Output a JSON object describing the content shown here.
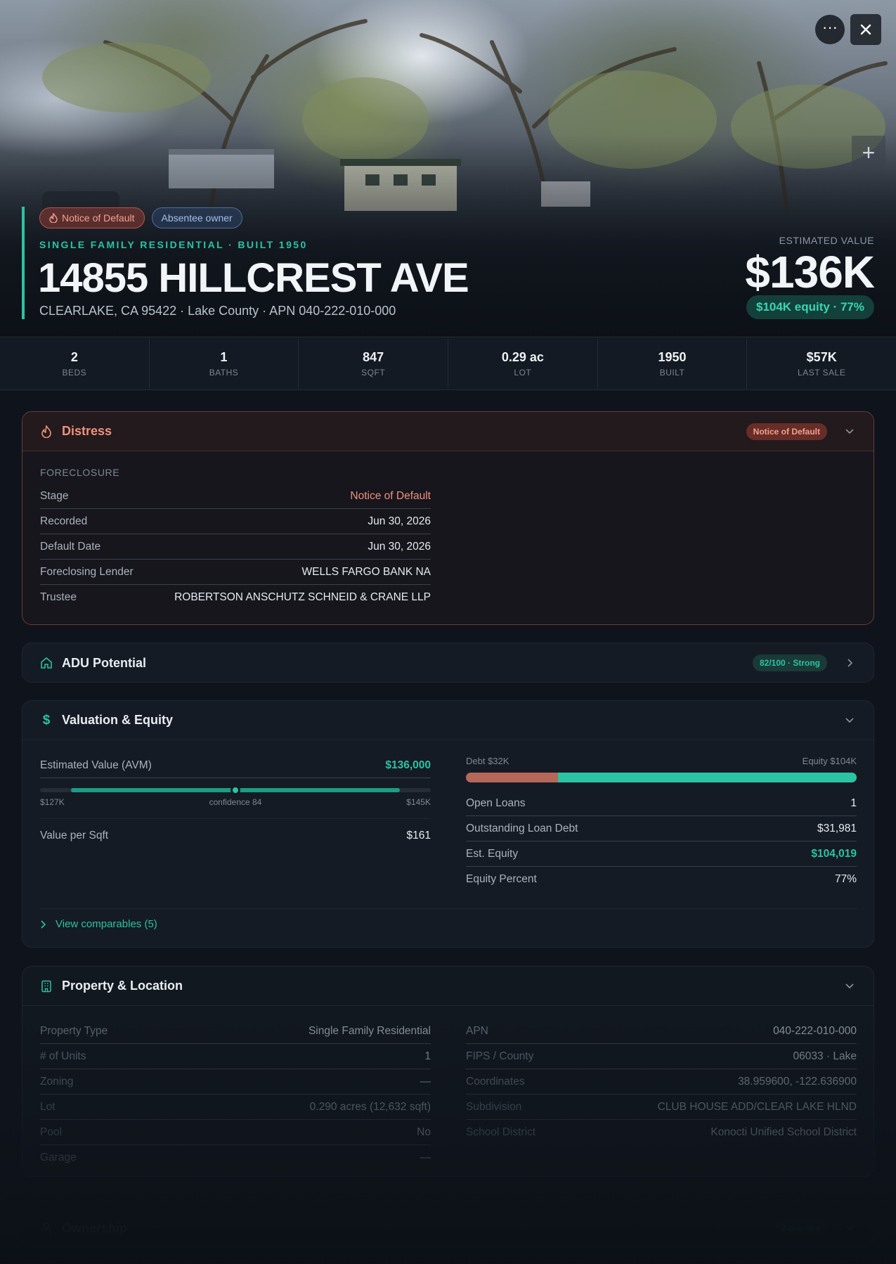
{
  "hero": {
    "chips": [
      {
        "label": "Notice of Default",
        "icon": "flame-icon"
      },
      {
        "label": "Absentee owner"
      }
    ],
    "subtitle": "SINGLE FAMILY RESIDENTIAL · BUILT 1950",
    "title": "14855 HILLCREST AVE",
    "address": "CLEARLAKE, CA 95422 · Lake County · APN 040-222-010-000",
    "estimated_label": "ESTIMATED VALUE",
    "estimated_value": "$136K",
    "equity_pill": "$104K equity · 77%",
    "more_icon": "ellipsis-icon",
    "close_icon": "close-icon",
    "zoom_icon": "plus-icon"
  },
  "stats": [
    {
      "value": "2",
      "label": "BEDS"
    },
    {
      "value": "1",
      "label": "BATHS"
    },
    {
      "value": "847",
      "label": "SQFT"
    },
    {
      "value": "0.29 ac",
      "label": "LOT"
    },
    {
      "value": "1950",
      "label": "BUILT"
    },
    {
      "value": "$57K",
      "label": "LAST SALE"
    }
  ],
  "distress": {
    "title": "Distress",
    "badge": "Notice of Default",
    "section": "FORECLOSURE",
    "rows": [
      {
        "k": "Stage",
        "v": "Notice of Default"
      },
      {
        "k": "Recorded",
        "v": "Jun 30, 2026"
      },
      {
        "k": "Default Date",
        "v": "Jun 30, 2026"
      },
      {
        "k": "Foreclosing Lender",
        "v": "WELLS FARGO BANK NA"
      },
      {
        "k": "Trustee",
        "v": "ROBERTSON ANSCHUTZ SCHNEID & CRANE LLP"
      }
    ]
  },
  "adu": {
    "title": "ADU Potential",
    "badge": "82/100 · Strong"
  },
  "valuation": {
    "title": "Valuation & Equity",
    "avm_label": "Estimated Value (AVM)",
    "avm_value": "$136,000",
    "avm_low": "$127K",
    "avm_high": "$145K",
    "avm_confidence": "confidence 84",
    "avm_range_start": 0.08,
    "avm_range_end": 0.92,
    "avm_point": 0.5,
    "value_per_sqft_label": "Value per Sqft",
    "value_per_sqft": "$161",
    "debt_label": "Debt $32K",
    "equity_label": "Equity $104K",
    "debt_fraction": 0.235,
    "debt_color": "#b5675a",
    "equity_color": "#2bc3a4",
    "rows": [
      {
        "k": "Open Loans",
        "v": "1"
      },
      {
        "k": "Outstanding Loan Debt",
        "v": "$31,981"
      },
      {
        "k": "Est. Equity",
        "v": "$104,019"
      },
      {
        "k": "Equity Percent",
        "v": "77%"
      }
    ],
    "comparables": "View comparables (5)"
  },
  "property": {
    "title": "Property & Location",
    "left": [
      {
        "k": "Property Type",
        "v": "Single Family Residential"
      },
      {
        "k": "# of Units",
        "v": "1"
      },
      {
        "k": "Zoning",
        "v": "—"
      },
      {
        "k": "Lot",
        "v": "0.290 acres (12,632 sqft)"
      },
      {
        "k": "Pool",
        "v": "No"
      },
      {
        "k": "Garage",
        "v": "—"
      }
    ],
    "right": [
      {
        "k": "APN",
        "v": "040-222-010-000"
      },
      {
        "k": "FIPS / County",
        "v": "06033 · Lake"
      },
      {
        "k": "Coordinates",
        "v": "38.959600, -122.636900"
      },
      {
        "k": "Subdivision",
        "v": "CLUB HOUSE ADD/CLEAR LAKE HLND"
      },
      {
        "k": "School District",
        "v": "Konocti Unified School District"
      }
    ]
  },
  "ownership": {
    "title": "Ownership",
    "badge": "Absentee"
  },
  "colors": {
    "accent": "#2bc3a4",
    "distress": "#f0907c",
    "background": "#0f141c"
  }
}
